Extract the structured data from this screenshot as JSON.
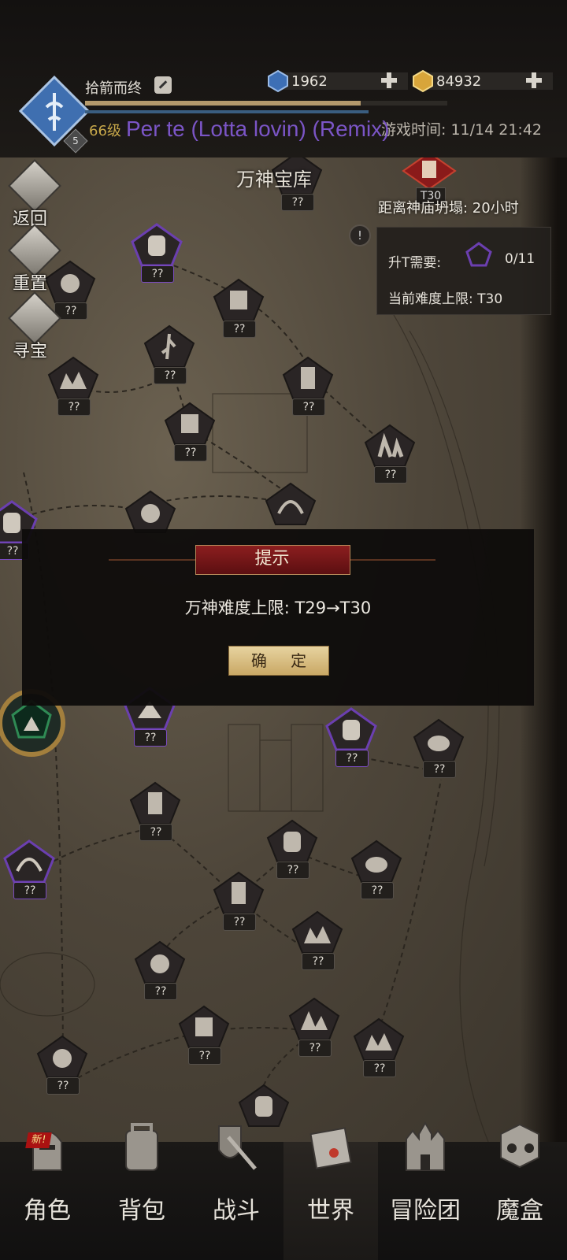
{
  "header": {
    "player_name": "拾箭而终",
    "level": "66级",
    "level_badge": "5",
    "now_playing": "Per te (Lotta lovin) (Remix)",
    "game_time": "游戏时间: 11/14 21:42",
    "xp_fraction": 0.76,
    "currencies": [
      {
        "name": "blue-gem",
        "value": "1962",
        "color": "#3d6fb5"
      },
      {
        "name": "gold-gem",
        "value": "84932",
        "color": "#d8a53a"
      }
    ]
  },
  "side_buttons": [
    {
      "name": "back",
      "label": "返回"
    },
    {
      "name": "reset",
      "label": "重置"
    },
    {
      "name": "treasure",
      "label": "寻宝"
    }
  ],
  "map": {
    "title": "万神宝库",
    "countdown": "距离神庙坍塌: 20小时",
    "red_node_label": "T30",
    "info": {
      "upgrade_label": "升T需要:",
      "upgrade_count": "0/11",
      "difficulty_label": "当前难度上限: T30"
    },
    "node_label": "??"
  },
  "dialog": {
    "title": "提示",
    "message": "万神难度上限: T29→T30",
    "confirm": "确 定"
  },
  "nav": [
    {
      "name": "character",
      "label": "角色",
      "badge": "新!"
    },
    {
      "name": "backpack",
      "label": "背包"
    },
    {
      "name": "battle",
      "label": "战斗"
    },
    {
      "name": "world",
      "label": "世界",
      "active": true
    },
    {
      "name": "adventure-team",
      "label": "冒险团"
    },
    {
      "name": "magic-box",
      "label": "魔盒"
    }
  ],
  "colors": {
    "accent_gold": "#c9a94a",
    "boss_purple": "#7a4bc0",
    "title_red": "#8c1e1f",
    "song_purple": "#7b55c6"
  }
}
